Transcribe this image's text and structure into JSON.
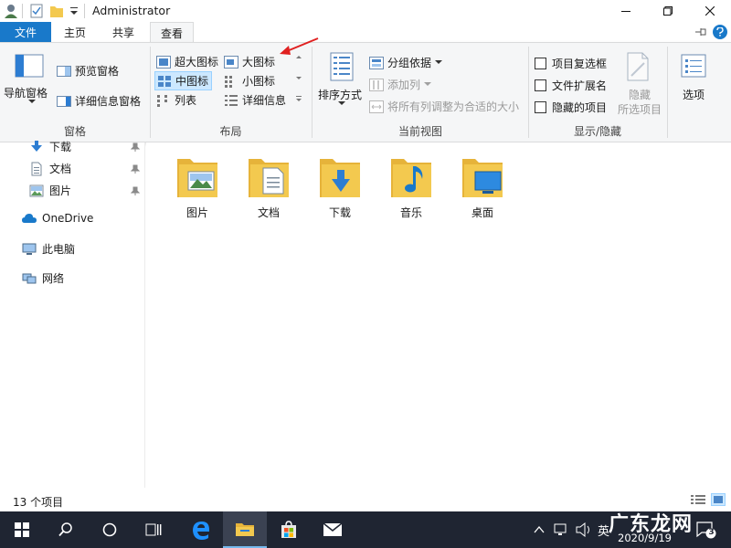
{
  "window": {
    "title": "Administrator"
  },
  "tabs": {
    "file": "文件",
    "home": "主页",
    "share": "共享",
    "view": "查看"
  },
  "panes": {
    "label": "窗格",
    "nav_pane": "导航窗格",
    "preview_pane": "预览窗格",
    "details_pane": "详细信息窗格"
  },
  "layout": {
    "label": "布局",
    "extra_large": "超大图标",
    "large": "大图标",
    "medium": "中图标",
    "small": "小图标",
    "list": "列表",
    "details": "详细信息"
  },
  "current_view": {
    "label": "当前视图",
    "sort_by": "排序方式",
    "group_by": "分组依据",
    "add_columns": "添加列",
    "size_all_columns": "将所有列调整为合适的大小"
  },
  "show_hide": {
    "label": "显示/隐藏",
    "item_checkboxes": "项目复选框",
    "file_extensions": "文件扩展名",
    "hidden_items": "隐藏的项目",
    "hide_selected_line1": "隐藏",
    "hide_selected_line2": "所选项目"
  },
  "options": {
    "label": "选项"
  },
  "nav": {
    "items": [
      "下载",
      "文档",
      "图片",
      "OneDrive",
      "此电脑",
      "网络"
    ]
  },
  "folders": [
    "图片",
    "文档",
    "下载",
    "音乐",
    "桌面"
  ],
  "status": {
    "count": "13 个项目"
  },
  "tray": {
    "ime": "英",
    "date": "2020/9/19",
    "notifications": "3",
    "watermark": "广东龙网"
  },
  "colors": {
    "accent": "#1979ca",
    "folder": "#f3c94f",
    "taskbar": "#1f2532",
    "arrow": "#e02020"
  }
}
